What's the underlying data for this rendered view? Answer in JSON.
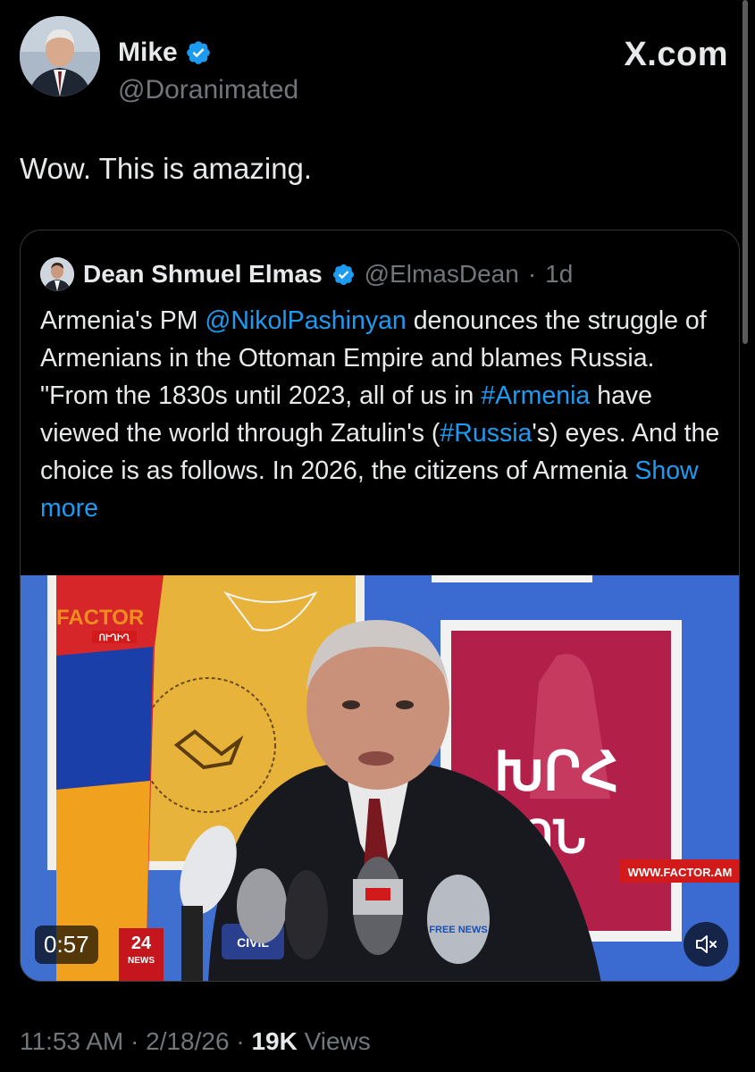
{
  "header": {
    "display_name": "Mike",
    "handle": "@Doranimated",
    "site": "X.com",
    "avatar_icon": "profile-photo",
    "verified_icon": "verified-badge-icon",
    "verified_color": "#1d9bf0"
  },
  "tweet": {
    "text": "Wow. This is amazing."
  },
  "quote": {
    "display_name": "Dean Shmuel Elmas",
    "handle": "@ElmasDean",
    "separator": "·",
    "time_ago": "1d",
    "body_1": "Armenia's PM ",
    "mention": "@NikolPashinyan",
    "body_2": " denounces the struggle of Armenians in the Ottoman Empire and blames Russia. \"From the 1830s until 2023, all of us in ",
    "hashtag_1": "#Armenia",
    "body_3": " have viewed the world through Zatulin's (",
    "hashtag_2": "#Russia",
    "body_4": "'s) eyes. And the choice is as follows. In 2026, the citizens of Armenia ",
    "show_more": "Show more",
    "link_color": "#1d9bf0"
  },
  "video": {
    "duration": "0:57",
    "watermark_brand": "FACTOR",
    "watermark_sub": "ՈՒՂԻՂ",
    "site_banner": "WWW.FACTOR.AM",
    "mic_label_24": "24",
    "mic_label_news": "NEWS",
    "mic_label_civil": "CIVIL",
    "mic_label_free": "FREE NEWS",
    "mute_icon": "speaker-muted-icon"
  },
  "meta": {
    "time": "11:53 AM",
    "sep1": " · ",
    "date": "2/18/26",
    "sep2": " · ",
    "views_count": "19K",
    "views_label": " Views"
  }
}
